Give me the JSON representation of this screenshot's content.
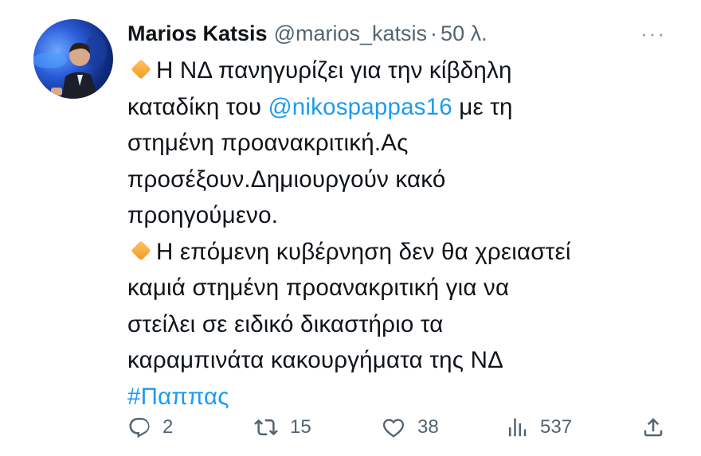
{
  "tweet": {
    "author_name": "Marios Katsis",
    "author_handle": "@marios_katsis",
    "separator": "·",
    "time": "50 λ.",
    "more_label": "···",
    "body": {
      "line1": "Η ΝΔ πανηγυρίζει για την κίβδηλη",
      "line2_prefix": "καταδίκη του ",
      "line2_mention": "@nikospappas16",
      "line2_suffix": " με τη",
      "line3": "στημένη προανακριτική.Ας",
      "line4": "προσέξουν.Δημιουργούν κακό",
      "line5": "προηγούμενο.",
      "line6": "Η επόμενη κυβέρνηση δεν θα χρειαστεί",
      "line7": "καμιά στημένη προανακριτική για να",
      "line8": "στείλει σε ειδικό δικαστήριο τα",
      "line9": "καραμπινάτα κακουργήματα της ΝΔ",
      "hashtag": "#Παππας"
    },
    "emoji": "large-orange-diamond",
    "colors": {
      "link": "#1d9bf0",
      "muted": "#536471",
      "text": "#0f1419"
    }
  },
  "actions": {
    "replies": "2",
    "retweets": "15",
    "likes": "38",
    "views": "537"
  },
  "icons": {
    "reply": "reply-icon",
    "retweet": "retweet-icon",
    "like": "heart-icon",
    "views": "views-icon",
    "share": "share-icon",
    "more": "more-icon"
  }
}
